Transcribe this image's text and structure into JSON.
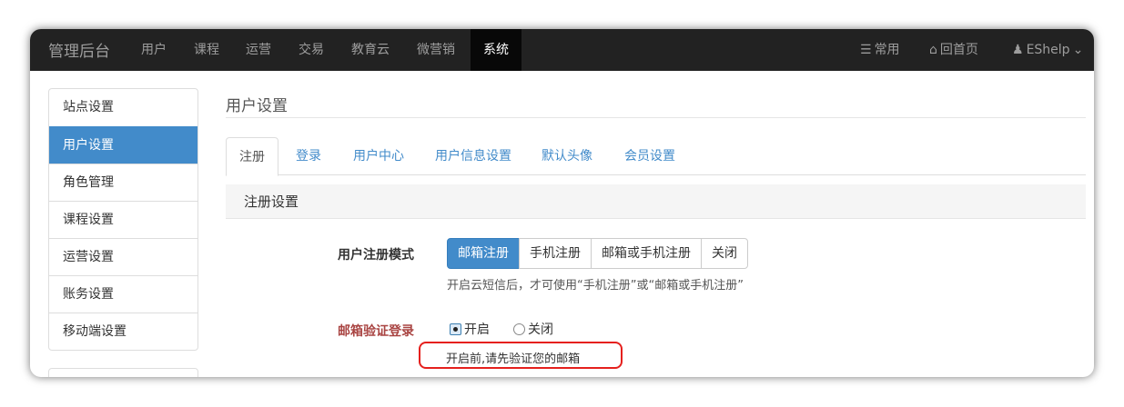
{
  "navbar": {
    "brand": "管理后台",
    "items": [
      "用户",
      "课程",
      "运营",
      "交易",
      "教育云",
      "微营销",
      "系统"
    ],
    "active": "系统",
    "right": {
      "common": "常用",
      "home": "回首页",
      "user": "EShelp"
    }
  },
  "sidebar": {
    "items": [
      "站点设置",
      "用户设置",
      "角色管理",
      "课程设置",
      "运营设置",
      "账务设置",
      "移动端设置"
    ],
    "active": "用户设置"
  },
  "page": {
    "title": "用户设置"
  },
  "tabs": {
    "items": [
      "注册",
      "登录",
      "用户中心",
      "用户信息设置",
      "默认头像",
      "会员设置"
    ],
    "active": "注册"
  },
  "section": {
    "title": "注册设置"
  },
  "register_mode": {
    "label": "用户注册模式",
    "options": [
      "邮箱注册",
      "手机注册",
      "邮箱或手机注册",
      "关闭"
    ],
    "selected": "邮箱注册",
    "help": "开启云短信后，才可使用“手机注册”或“邮箱或手机注册”"
  },
  "email_verify": {
    "label": "邮箱验证登录",
    "options": [
      "开启",
      "关闭"
    ],
    "selected": "开启",
    "help": "开启前,请先验证您的邮箱"
  },
  "colors": {
    "navbar_bg": "#222222",
    "primary": "#428bca",
    "error_label": "#a94442",
    "highlight": "#e5201d"
  }
}
